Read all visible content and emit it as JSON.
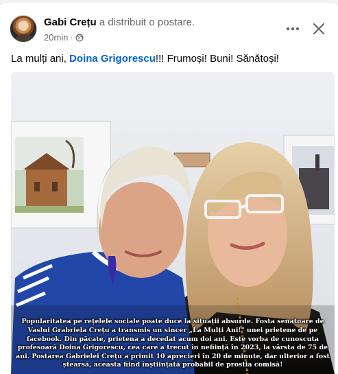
{
  "post": {
    "author": "Gabi Crețu",
    "action": "a distribuit o postare.",
    "time": "20min",
    "separator": "·",
    "text_before": "La mulți ani, ",
    "mention": "Doina Grigorescu",
    "text_after": "!!! Frumoși! Buni! Sănătoși!"
  },
  "photo": {
    "caption": "Popularitatea pe rețelele sociale poate duce la situații absurde. Fosta senatoare de Vaslui Grabriela Crețu a transmis un sincer „La Mulți Ani!\" unei prietene de pe facebook. Din păcate, prietena a decedat acum doi ani. Este vorba de cunoscuta profesoară Doina Grigorescu, cea care a trecut în neființă în 2023, la vârsta de 75 de ani. Postarea Gabrielei Crețu a primit 10 aprecieri în 20 de minute, dar ulterior a fost ștearsă, aceasta fiind înștiințată probabil de prostia comisă!"
  },
  "icons": {
    "privacy": "globe-icon",
    "more": "more-options-icon",
    "close": "close-icon"
  },
  "colors": {
    "link": "#0064d1",
    "secondary_text": "#65676b",
    "background": "#f0f2f5"
  }
}
